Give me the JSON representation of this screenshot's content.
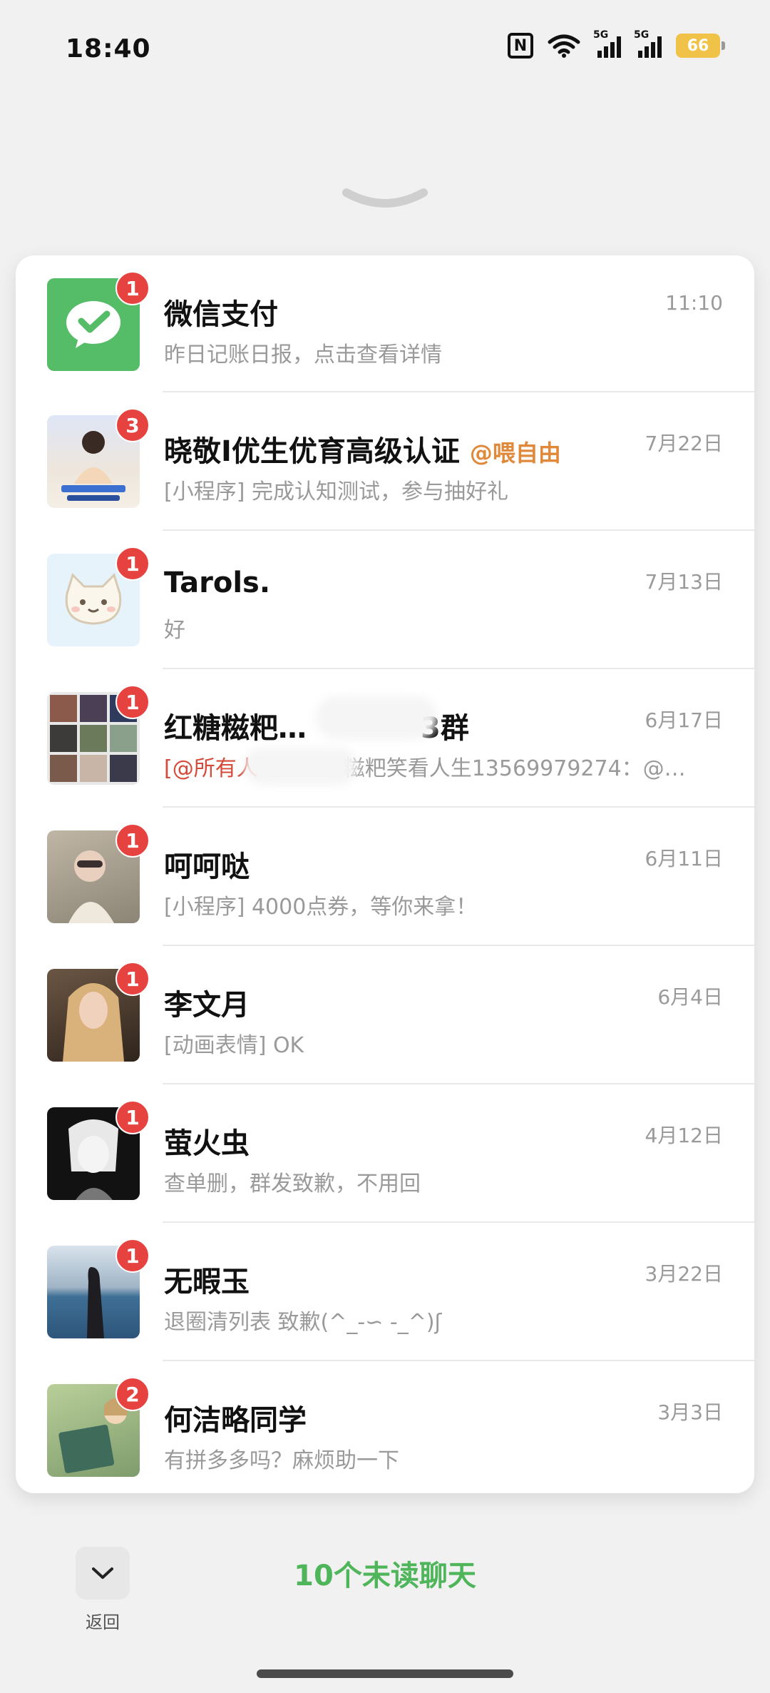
{
  "status_bar": {
    "time": "18:40",
    "battery": "66",
    "signal_label": "5G"
  },
  "chats": [
    {
      "name": "微信支付",
      "at_tag": "",
      "preview": "昨日记账日报，点击查看详情",
      "mention": "",
      "date": "11:10",
      "badge": "1"
    },
    {
      "name": "晓敬I优生优育高级认证",
      "at_tag": "@喂自由",
      "preview": "[小程序] 完成认知测试，参与抽好礼",
      "mention": "",
      "date": "7月22日",
      "badge": "3"
    },
    {
      "name": "Tarols.",
      "at_tag": "",
      "preview": "好",
      "mention": "",
      "date": "7月13日",
      "badge": "1"
    },
    {
      "name": "红糖糍粑…　　　　3群",
      "at_tag": "",
      "preview": "　　　　糍粑笑看人生13569979274：@…",
      "mention": "[@所有人",
      "date": "6月17日",
      "badge": "1"
    },
    {
      "name": "呵呵哒",
      "at_tag": "",
      "preview": "[小程序] 4000点券，等你来拿！",
      "mention": "",
      "date": "6月11日",
      "badge": "1"
    },
    {
      "name": "李文月",
      "at_tag": "",
      "preview": "[动画表情] OK",
      "mention": "",
      "date": "6月4日",
      "badge": "1"
    },
    {
      "name": "萤火虫",
      "at_tag": "",
      "preview": "查单删，群发致歉，不用回",
      "mention": "",
      "date": "4月12日",
      "badge": "1"
    },
    {
      "name": "无暇玉",
      "at_tag": "",
      "preview": "退圈清列表 致歉(^_-∽ -_^)ʃ",
      "mention": "",
      "date": "3月22日",
      "badge": "1"
    },
    {
      "name": "何洁略同学",
      "at_tag": "",
      "preview": "有拼多多吗？麻烦助一下",
      "mention": "",
      "date": "3月3日",
      "badge": "2"
    }
  ],
  "footer": {
    "back_label": "返回",
    "unread_summary": "10个未读聊天"
  },
  "colors": {
    "accent_green": "#4eb55b",
    "badge_red": "#e64340",
    "at_orange": "#e0893b"
  }
}
